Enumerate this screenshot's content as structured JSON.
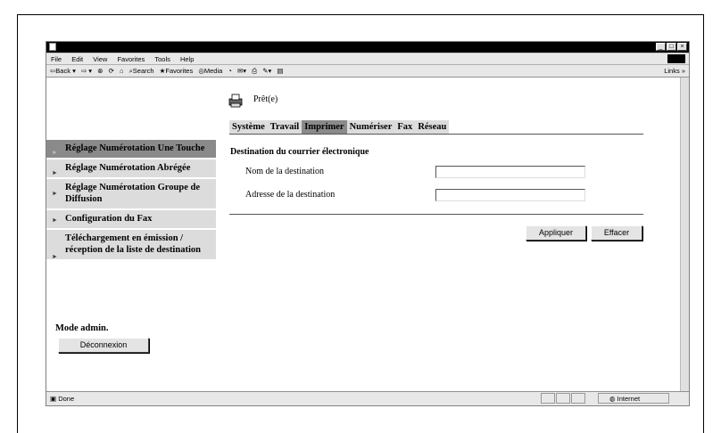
{
  "browser": {
    "menu": [
      "File",
      "Edit",
      "View",
      "Favorites",
      "Tools",
      "Help"
    ],
    "toolbar": {
      "back": "Back",
      "search": "Search",
      "favorites": "Favorites",
      "media": "Media",
      "links": "Links"
    },
    "status": {
      "text": "Done",
      "zone": "Internet"
    }
  },
  "page": {
    "status": "Prêt(e)",
    "tabs": [
      "Système",
      "Travail",
      "Imprimer",
      "Numériser",
      "Fax",
      "Réseau"
    ],
    "active_tab": "Imprimer",
    "nav": [
      {
        "label": "Réglage Numérotation Une Touche",
        "active": true
      },
      {
        "label": "Réglage Numérotation Abrégée",
        "active": false
      },
      {
        "label": "Réglage Numérotation Groupe de Diffusion",
        "active": false
      },
      {
        "label": "Configuration du Fax",
        "active": false
      },
      {
        "label": "Téléchargement en émission / réception de la liste de destination",
        "active": false
      }
    ],
    "admin_label": "Mode admin.",
    "logout_button": "Déconnexion",
    "section_title": "Destination du courrier électronique",
    "fields": [
      {
        "label": "Nom de la destination",
        "value": ""
      },
      {
        "label": "Adresse de la destination",
        "value": ""
      }
    ],
    "apply_button": "Appliquer",
    "clear_button": "Effacer"
  }
}
